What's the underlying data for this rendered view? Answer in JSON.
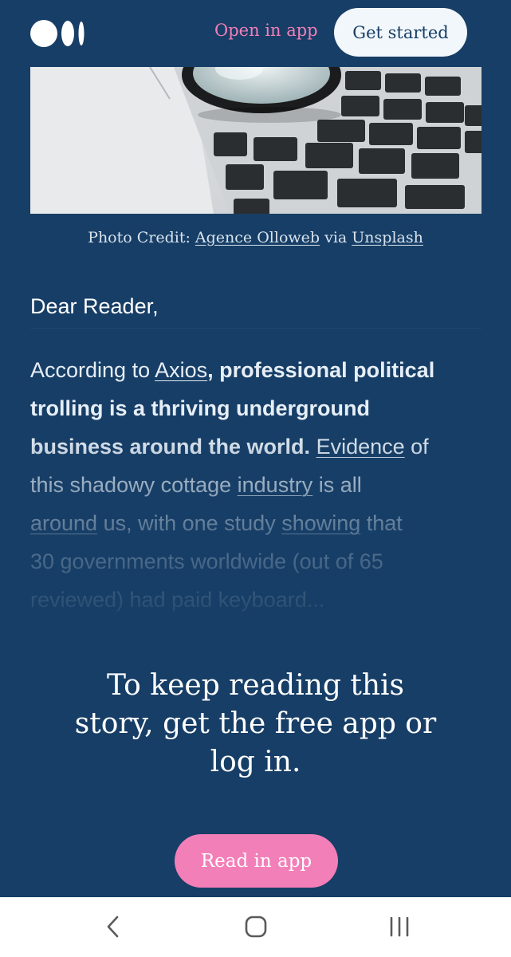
{
  "header": {
    "logo_icon": "medium-logo-icon",
    "open_in_app": "Open in app",
    "get_started": "Get started"
  },
  "hero": {
    "image_icon": "keyboard-magnifier-photo"
  },
  "caption": {
    "prefix": "Photo Credit: ",
    "photographer": "Agence Olloweb",
    "via": " via ",
    "source": "Unsplash"
  },
  "article": {
    "greeting": "Dear Reader,",
    "lines": [
      {
        "a": "According to ",
        "link": "Axios",
        "comma": ",",
        "bold": " professional political"
      },
      {
        "bold": "trolling is a thriving underground"
      },
      {
        "bold": "business around the world.",
        "space": " ",
        "link": "Evidence",
        "after": " of"
      },
      {
        "before": "this shadowy cottage ",
        "link": "industry",
        "after": " is all"
      },
      {
        "link": "around",
        "mid": " us, with one study ",
        "link2": "showing",
        "after": " that"
      },
      {
        "text": "30 governments worldwide (out of 65"
      },
      {
        "text": "reviewed) had paid keyboard..."
      }
    ]
  },
  "paywall": {
    "line1": "To keep reading this",
    "line2": "story, get the free app or",
    "line3": "log in.",
    "read_in_app": "Read in app"
  },
  "system_nav": {
    "back_icon": "back-chevron-icon",
    "home_icon": "home-icon",
    "recents_icon": "recents-icon"
  },
  "colors": {
    "background": "#173e66",
    "accent_pink": "#f37fb8",
    "button_light": "#f2f7fb",
    "nav_bar": "#ffffff"
  }
}
